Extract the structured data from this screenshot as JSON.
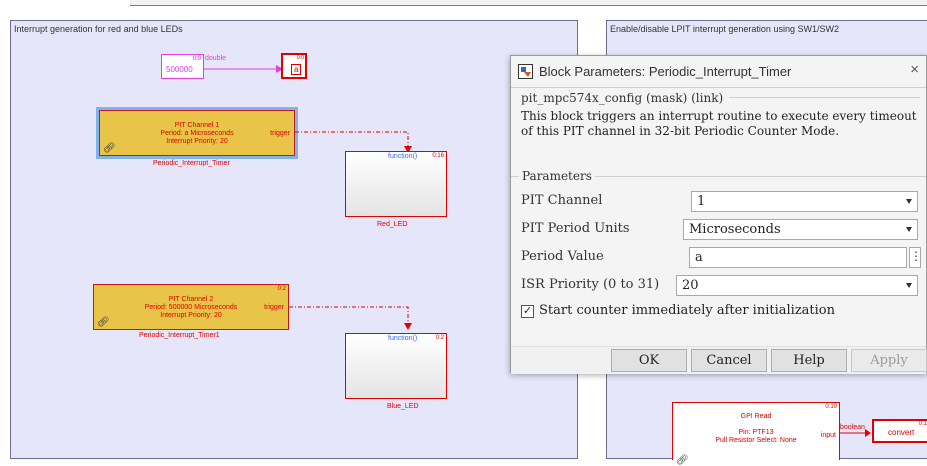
{
  "left_area": {
    "title": "Interrupt generation for red and blue LEDs",
    "constant": {
      "value": "500000",
      "port": "0:0",
      "type": "double"
    },
    "var_block": {
      "label": "a",
      "port": "0:0"
    },
    "pit1": {
      "line1": "PIT Channel 1",
      "line2": "Period: a Microseconds",
      "line3": "Interrupt Priority: 20",
      "trigger": "trigger",
      "name": "Periodic_Interrupt_Timer"
    },
    "red_led": {
      "port_text": "function()",
      "port": "0:16",
      "name": "Red_LED"
    },
    "pit2": {
      "port": "0:2",
      "line1": "PIT Channel 2",
      "line2": "Period: 500000 Microseconds",
      "line3": "Interrupt Priority: 20",
      "trigger": "trigger",
      "name": "Periodic_Interrupt_Timer1"
    },
    "blue_led": {
      "port_text": "function()",
      "port": "0:2",
      "name": "Blue_LED"
    }
  },
  "right_area": {
    "title": "Enable/disable LPIT interrupt generation using SW1/SW2",
    "gpi": {
      "port": "0:10",
      "title": "GPI Read",
      "line1": "Pin: PTF13",
      "line2": "Pull Resistor Select: None",
      "output": "input"
    },
    "signal_type": "boolean",
    "convert": {
      "label": "convert",
      "port": "0:1"
    }
  },
  "dialog": {
    "title": "Block Parameters: Periodic_Interrupt_Timer",
    "mask_header": "pit_mpc574x_config (mask) (link)",
    "description": "This block triggers an interrupt routine to execute every timeout of this PIT channel in 32-bit Periodic Counter Mode.",
    "parameters_title": "Parameters",
    "fields": {
      "pit_channel": {
        "label": "PIT Channel",
        "value": "1"
      },
      "period_units": {
        "label": "PIT Period Units",
        "value": "Microseconds"
      },
      "period_value": {
        "label": "Period Value",
        "value": "a",
        "menu": "⋮"
      },
      "isr_priority": {
        "label": "ISR Priority (0 to 31)",
        "value": "20"
      }
    },
    "start_counter": {
      "label": "Start counter immediately after initialization",
      "checked": true,
      "mark": "✓"
    },
    "buttons": {
      "ok": "OK",
      "cancel": "Cancel",
      "help": "Help",
      "apply": "Apply"
    },
    "close": "×"
  },
  "colors": {
    "canvas_area": "#e6e6fb",
    "pit_block": "#e8c548",
    "signal_red": "#e00000",
    "selection": "#7fb3f0"
  }
}
